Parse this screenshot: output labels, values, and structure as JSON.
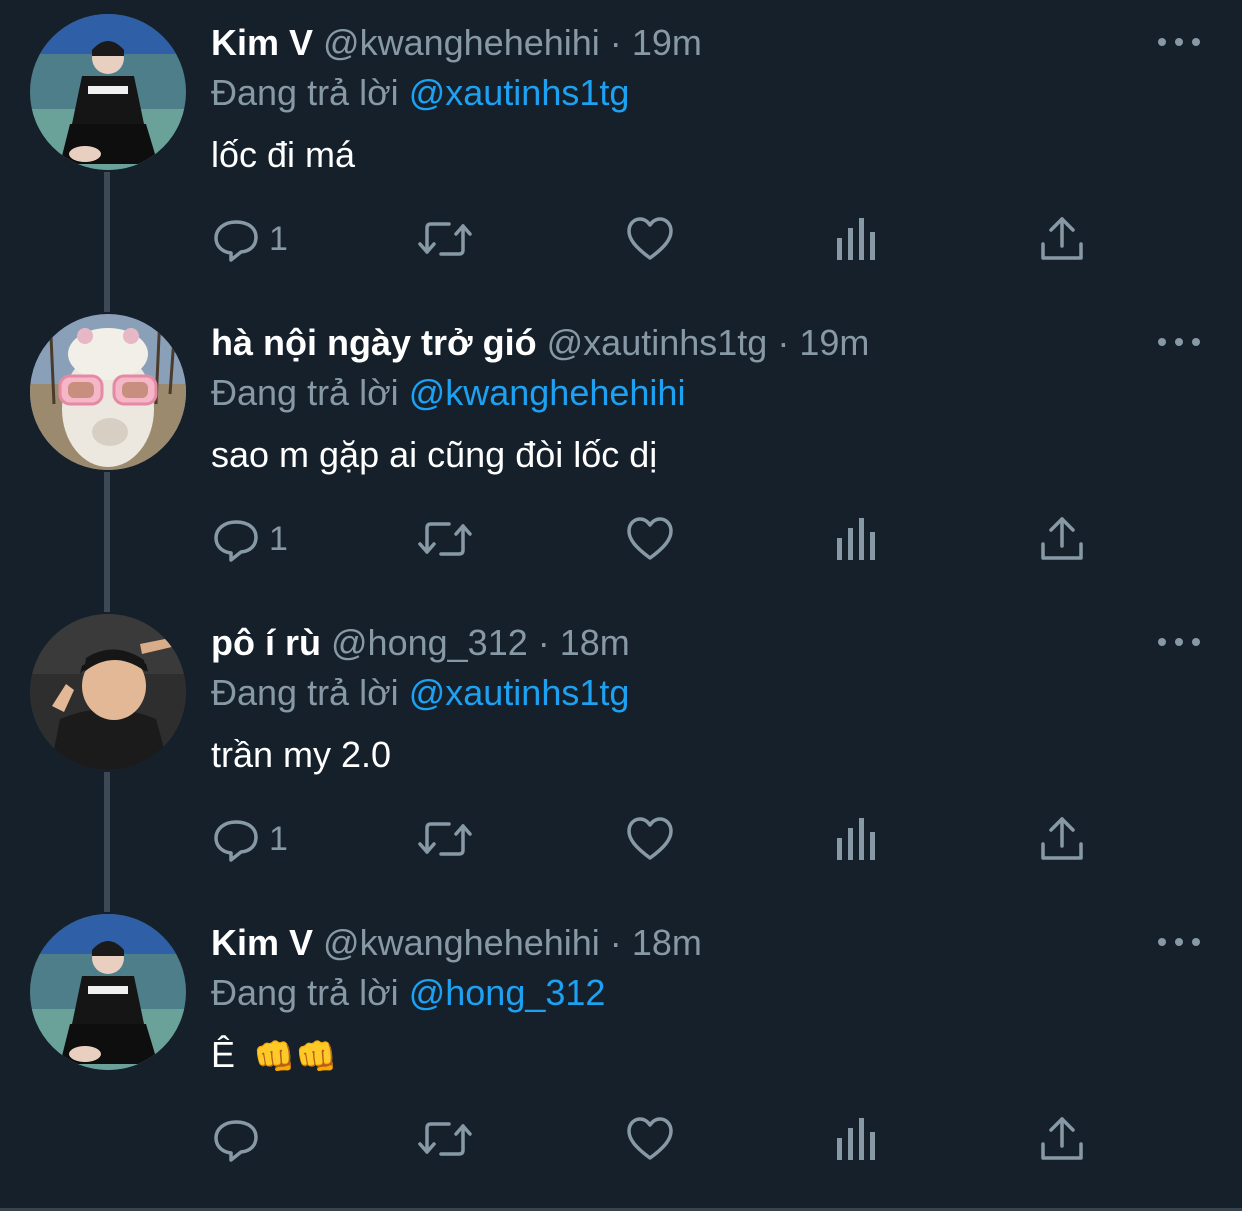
{
  "reply_prefix": "Đang trả lời",
  "tweets": [
    {
      "name": "Kim V",
      "handle": "@kwanghehehihi",
      "time": "19m",
      "reply_to": "@xautinhs1tg",
      "text": "lốc đi má",
      "reply_count": "1",
      "avatar": "avatar-kim-v"
    },
    {
      "name": "hà nội ngày trở gió",
      "handle": "@xautinhs1tg",
      "time": "19m",
      "reply_to": "@kwanghehehihi",
      "text": "sao m gặp ai cũng đòi lốc dị",
      "reply_count": "1",
      "avatar": "avatar-alpaca"
    },
    {
      "name": "pô í rù",
      "handle": "@hong_312",
      "time": "18m",
      "reply_to": "@xautinhs1tg",
      "text": "trần my 2.0",
      "reply_count": "1",
      "avatar": "avatar-po-i-ru"
    },
    {
      "name": "Kim V",
      "handle": "@kwanghehehihi",
      "time": "18m",
      "reply_to": "@hong_312",
      "text": "Ê",
      "emoji": "👊👊",
      "reply_count": "",
      "avatar": "avatar-kim-v"
    }
  ],
  "colors": {
    "background": "#15202b",
    "muted": "#8899a6",
    "accent": "#1da1f2",
    "thread_line": "#3d4954"
  },
  "icons": [
    "reply-icon",
    "retweet-icon",
    "like-icon",
    "analytics-icon",
    "share-icon",
    "more-icon"
  ]
}
